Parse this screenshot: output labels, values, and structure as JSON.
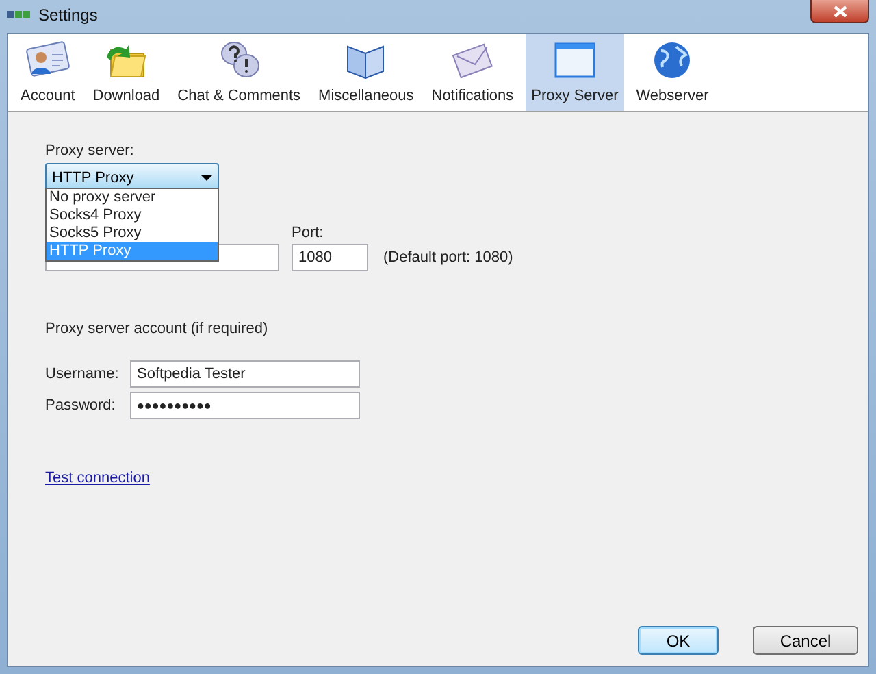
{
  "window": {
    "title": "Settings"
  },
  "tabs": [
    {
      "label": "Account",
      "selected": false
    },
    {
      "label": "Download",
      "selected": false
    },
    {
      "label": "Chat & Comments",
      "selected": false
    },
    {
      "label": "Miscellaneous",
      "selected": false
    },
    {
      "label": "Notifications",
      "selected": false
    },
    {
      "label": "Proxy Server",
      "selected": true
    },
    {
      "label": "Webserver",
      "selected": false
    }
  ],
  "proxy_server": {
    "label": "Proxy server:",
    "value": "HTTP Proxy",
    "expanded": true,
    "options": [
      {
        "label": "No proxy server",
        "selected": false
      },
      {
        "label": "Socks4 Proxy",
        "selected": false
      },
      {
        "label": "Socks5 Proxy",
        "selected": false
      },
      {
        "label": "HTTP Proxy",
        "selected": true
      }
    ]
  },
  "port": {
    "label": "Port:",
    "value": "1080",
    "hint": "(Default port: 1080)"
  },
  "account": {
    "heading": "Proxy server account (if required)",
    "username": {
      "label": "Username:",
      "value": "Softpedia Tester"
    },
    "password": {
      "label": "Password:",
      "value": "●●●●●●●●●●"
    }
  },
  "test_link": "Test connection",
  "buttons": [
    {
      "label": "OK",
      "default": true
    },
    {
      "label": "Cancel",
      "default": false
    }
  ]
}
